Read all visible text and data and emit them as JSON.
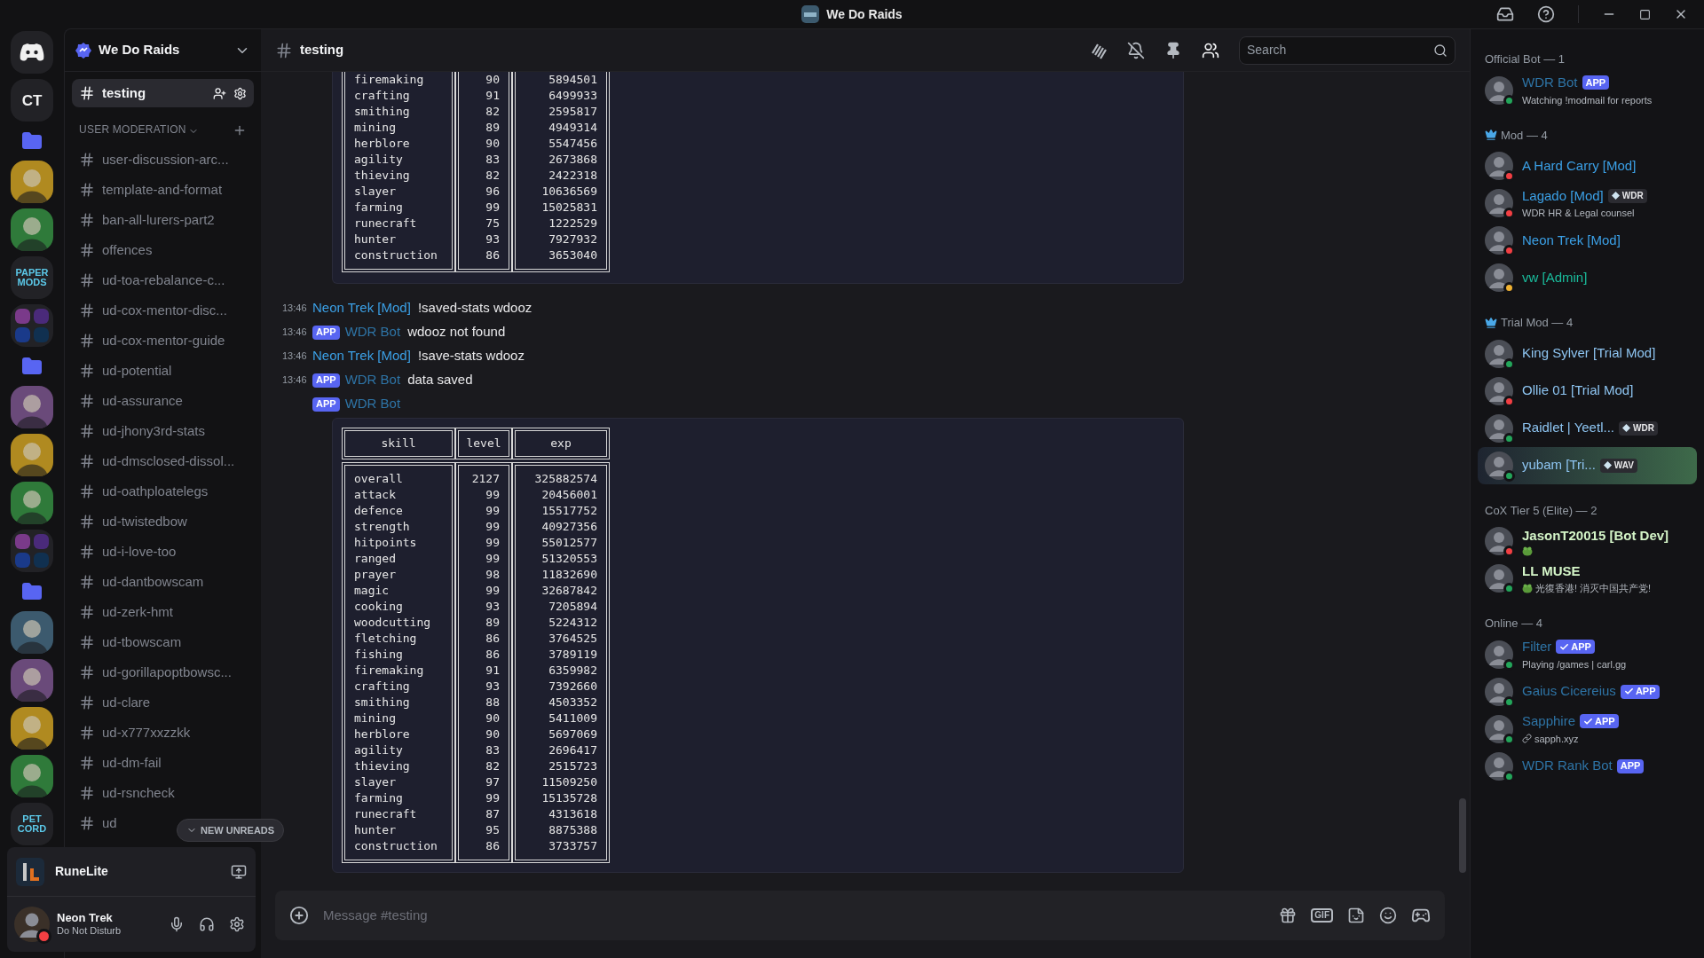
{
  "window": {
    "title": "We Do Raids"
  },
  "servers": [
    {
      "kind": "logo"
    },
    {
      "kind": "text",
      "label": "CT"
    },
    {
      "kind": "folder"
    },
    {
      "kind": "picture"
    },
    {
      "kind": "picture"
    },
    {
      "kind": "text",
      "label": "PAPER MODS"
    },
    {
      "kind": "grid"
    },
    {
      "kind": "folder"
    },
    {
      "kind": "picture"
    },
    {
      "kind": "picture"
    },
    {
      "kind": "picture"
    },
    {
      "kind": "grid"
    },
    {
      "kind": "folder"
    },
    {
      "kind": "picture"
    },
    {
      "kind": "picture"
    },
    {
      "kind": "picture"
    },
    {
      "kind": "picture"
    },
    {
      "kind": "text",
      "label": "PET CORD"
    }
  ],
  "server_name": "We Do Raids",
  "current_channel": {
    "name": "testing",
    "selected": true
  },
  "category": "USER MODERATION",
  "channels": [
    "user-discussion-arc...",
    "template-and-format",
    "ban-all-lurers-part2",
    "offences",
    "ud-toa-rebalance-c...",
    "ud-cox-mentor-disc...",
    "ud-cox-mentor-guide",
    "ud-potential",
    "ud-assurance",
    "ud-jhony3rd-stats",
    "ud-dmsclosed-dissol...",
    "ud-oathploatelegs",
    "ud-twistedbow",
    "ud-i-love-too",
    "ud-dantbowscam",
    "ud-zerk-hmt",
    "ud-tbowscam",
    "ud-gorillapoptbowsc...",
    "ud-clare",
    "ud-x777xxzzkk",
    "ud-dm-fail",
    "ud-rsncheck",
    "ud"
  ],
  "new_unreads": "NEW UNREADS",
  "activity": {
    "name": "RuneLite"
  },
  "user": {
    "name": "Neon Trek",
    "status_text": "Do Not Disturb",
    "status": {
      "color": "#f23f43"
    }
  },
  "header": {
    "channel": "testing",
    "search_placeholder": "Search"
  },
  "messages": [
    {
      "table": {
        "rows": [
          [
            "firemaking",
            "90",
            "5894501"
          ],
          [
            "crafting",
            "91",
            "6499933"
          ],
          [
            "smithing",
            "82",
            "2595817"
          ],
          [
            "mining",
            "89",
            "4949314"
          ],
          [
            "herblore",
            "90",
            "5547456"
          ],
          [
            "agility",
            "83",
            "2673868"
          ],
          [
            "thieving",
            "82",
            "2422318"
          ],
          [
            "slayer",
            "96",
            "10636569"
          ],
          [
            "farming",
            "99",
            "15025831"
          ],
          [
            "runecraft",
            "75",
            "1222529"
          ],
          [
            "hunter",
            "93",
            "7927932"
          ],
          [
            "construction",
            "86",
            "3653040"
          ]
        ]
      }
    },
    {
      "time": "13:46",
      "author": "Neon Trek [Mod]",
      "color": "#3ba0e6",
      "text": "!saved-stats wdooz"
    },
    {
      "time": "13:46",
      "badge": "APP",
      "author": "WDR Bot",
      "color": "#2e74a6",
      "text": "wdooz not found"
    },
    {
      "time": "13:46",
      "author": "Neon Trek [Mod]",
      "color": "#3ba0e6",
      "text": "!save-stats wdooz"
    },
    {
      "time": "13:46",
      "badge": "APP",
      "author": "WDR Bot",
      "color": "#2e74a6",
      "text": "data saved"
    },
    {
      "badge": "APP",
      "author": "WDR Bot",
      "color": "#2e74a6",
      "table": {
        "columns": [
          "skill",
          "level",
          "exp"
        ],
        "rows": [
          [
            "overall",
            "2127",
            "325882574"
          ],
          [
            "attack",
            "99",
            "20456001"
          ],
          [
            "defence",
            "99",
            "15517752"
          ],
          [
            "strength",
            "99",
            "40927356"
          ],
          [
            "hitpoints",
            "99",
            "55012577"
          ],
          [
            "ranged",
            "99",
            "51320553"
          ],
          [
            "prayer",
            "98",
            "11832690"
          ],
          [
            "magic",
            "99",
            "32687842"
          ],
          [
            "cooking",
            "93",
            "7205894"
          ],
          [
            "woodcutting",
            "89",
            "5224312"
          ],
          [
            "fletching",
            "86",
            "3764525"
          ],
          [
            "fishing",
            "86",
            "3789119"
          ],
          [
            "firemaking",
            "91",
            "6359982"
          ],
          [
            "crafting",
            "93",
            "7392660"
          ],
          [
            "smithing",
            "88",
            "4503352"
          ],
          [
            "mining",
            "90",
            "5411009"
          ],
          [
            "herblore",
            "90",
            "5697069"
          ],
          [
            "agility",
            "83",
            "2696417"
          ],
          [
            "thieving",
            "82",
            "2515723"
          ],
          [
            "slayer",
            "97",
            "11509250"
          ],
          [
            "farming",
            "99",
            "15135728"
          ],
          [
            "runecraft",
            "87",
            "4313618"
          ],
          [
            "hunter",
            "95",
            "8875388"
          ],
          [
            "construction",
            "86",
            "3733757"
          ]
        ]
      }
    }
  ],
  "composer": {
    "placeholder": "Message #testing",
    "gif": "GIF"
  },
  "member_groups": [
    {
      "title": "Official Bot — 1",
      "crown": false,
      "members": [
        {
          "name": "WDR Bot",
          "color": "#2e74a6",
          "badge": "APP",
          "verified": false,
          "subtitle": "Watching !modmail for reports",
          "status": {
            "color": "#23a55a"
          }
        }
      ]
    },
    {
      "title": "Mod — 4",
      "crown": true,
      "members": [
        {
          "name": "A Hard Carry [Mod]",
          "color": "#3ba0e6",
          "status": {
            "color": "#f23f43"
          }
        },
        {
          "name": "Lagado [Mod]",
          "color": "#3ba0e6",
          "tag": "WDR",
          "subtitle": "WDR HR & Legal counsel",
          "status": {
            "color": "#f23f43"
          }
        },
        {
          "name": "Neon Trek [Mod]",
          "color": "#3ba0e6",
          "status": {
            "color": "#f23f43"
          }
        },
        {
          "name": "vw [Admin]",
          "color": "#1abc9c",
          "status": {
            "color": "#f0b232"
          }
        }
      ]
    },
    {
      "title": "Trial Mod — 4",
      "crown": true,
      "members": [
        {
          "name": "King Sylver [Trial Mod]",
          "color": "#8ec5f2",
          "status": {
            "color": "#23a55a"
          }
        },
        {
          "name": "Ollie 01 [Trial Mod]",
          "color": "#8ec5f2",
          "status": {
            "color": "#f23f43"
          }
        },
        {
          "name": "Raidlet | Yeetl...",
          "color": "#8ec5f2",
          "tag": "WDR",
          "status": {
            "color": "#23a55a"
          }
        },
        {
          "name": "yubam [Tri...",
          "color": "#8ec5f2",
          "tag": "WAV",
          "status": {
            "color": "#23a55a"
          },
          "nameplate": true
        }
      ]
    },
    {
      "title": "CoX Tier 5 (Elite) — 2",
      "crown": false,
      "members": [
        {
          "name": "JasonT20015 [Bot Dev]",
          "color": "#d4f5c8",
          "bold": true,
          "emoji_status": true,
          "status": {
            "color": "#f23f43"
          }
        },
        {
          "name": "LL MUSE",
          "color": "#d4f5c8",
          "bold": true,
          "emoji_status": true,
          "subtitle": "光復香港! 消灭中国共产党!",
          "status": {
            "color": "#23a55a"
          }
        }
      ]
    },
    {
      "title": "Online — 4",
      "crown": false,
      "members": [
        {
          "name": "Filter",
          "color": "#2e74a6",
          "badge": "APP",
          "verified": true,
          "subtitle": "Playing /games | carl.gg",
          "status": {
            "color": "#23a55a"
          }
        },
        {
          "name": "Gaius Cicereius",
          "color": "#2e74a6",
          "badge": "APP",
          "verified": true,
          "status": {
            "color": "#23a55a"
          }
        },
        {
          "name": "Sapphire",
          "color": "#2e74a6",
          "badge": "APP",
          "verified": true,
          "subtitle": "sapph.xyz",
          "link": true,
          "status": {
            "color": "#23a55a"
          }
        },
        {
          "name": "WDR Rank Bot",
          "color": "#2e74a6",
          "badge": "APP",
          "verified": false,
          "status": {
            "color": "#23a55a"
          }
        }
      ]
    }
  ]
}
